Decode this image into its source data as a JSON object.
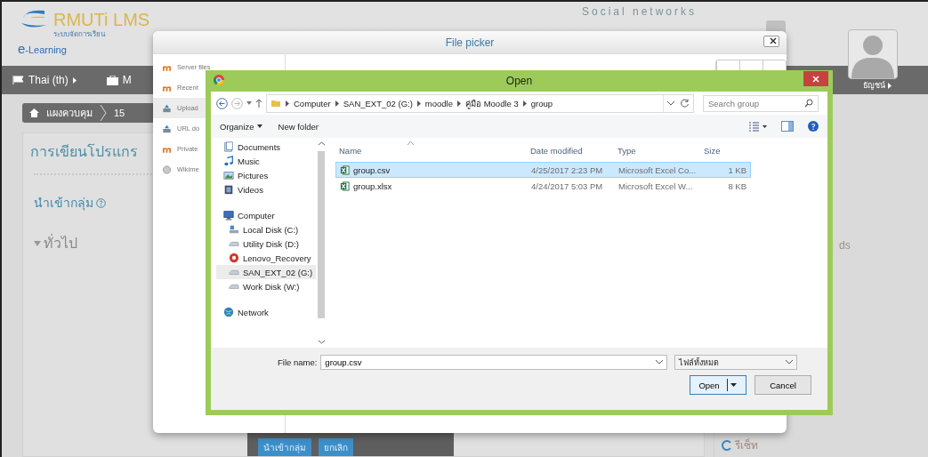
{
  "header": {
    "logo_title": "RMUTi LMS",
    "logo_subtitle": "ระบบจัดการเรียน",
    "logo_tagline": "e-Learning",
    "social_title": "Social networks"
  },
  "navbar": {
    "items": [
      {
        "label": "Thai (th)",
        "kind": "language"
      },
      {
        "label": "M",
        "kind": "courses"
      }
    ],
    "user": "ธัญชน์"
  },
  "breadcrumb": [
    "แผงควบคุม",
    "15"
  ],
  "page": {
    "title": "การเขียนโปรแกร",
    "heading": "นำเข้ากลุ่ม",
    "section": {
      "label": "ทั่วไป",
      "expanded": true
    },
    "buttons": [
      "นำเข้ากลุ่ม",
      "ยกเลิก"
    ]
  },
  "side": {
    "fragment": "ds",
    "reset": "รีเซ็ท"
  },
  "file_picker": {
    "title": "File picker",
    "repositories": [
      {
        "label": "Server files",
        "kind": "moodle",
        "selected": false
      },
      {
        "label": "Recent",
        "kind": "moodle",
        "selected": false
      },
      {
        "label": "Upload",
        "kind": "upload",
        "selected": true
      },
      {
        "label": "URL do",
        "kind": "upload",
        "selected": false
      },
      {
        "label": "Private",
        "kind": "moodle",
        "selected": false
      },
      {
        "label": "Wikime",
        "kind": "wiki",
        "selected": false
      }
    ]
  },
  "open_dialog": {
    "title": "Open",
    "path": [
      "Computer",
      "SAN_EXT_02 (G:)",
      "moodle",
      "คู่มือ Moodle 3",
      "group"
    ],
    "search": {
      "placeholder": "Search group"
    },
    "toolbar": [
      "Organize",
      "New folder"
    ],
    "nav": [
      {
        "label": "Documents",
        "kind": "documents",
        "selected": false
      },
      {
        "label": "Music",
        "kind": "music",
        "selected": false
      },
      {
        "label": "Pictures",
        "kind": "pictures",
        "selected": false
      },
      {
        "label": "Videos",
        "kind": "videos",
        "selected": false
      },
      {
        "label": "Computer",
        "kind": "computer",
        "selected": false,
        "children": [
          {
            "label": "Local Disk (C:)",
            "kind": "system",
            "selected": false
          },
          {
            "label": "Utility Disk (D:)",
            "kind": "disk",
            "selected": false
          },
          {
            "label": "Lenovo_Recovery",
            "kind": "recovery",
            "selected": false
          },
          {
            "label": "SAN_EXT_02 (G:)",
            "kind": "disk",
            "selected": true
          },
          {
            "label": "Work Disk (W:)",
            "kind": "disk",
            "selected": false
          }
        ]
      },
      {
        "label": "Network",
        "kind": "network",
        "selected": false
      }
    ],
    "columns": [
      "Name",
      "Date modified",
      "Type",
      "Size"
    ],
    "files": [
      {
        "name": "group.csv",
        "date": "4/25/2017 2:23 PM",
        "type": "Microsoft Excel Co...",
        "size": "1 KB",
        "selected": true
      },
      {
        "name": "group.xlsx",
        "date": "4/24/2017 5:03 PM",
        "type": "Microsoft Excel W...",
        "size": "8 KB",
        "selected": false
      }
    ],
    "file_name_label": "File name:",
    "file_name": "group.csv",
    "filter": "ไฟล์ทั้งหมด",
    "buttons": [
      "Open",
      "Cancel"
    ]
  }
}
